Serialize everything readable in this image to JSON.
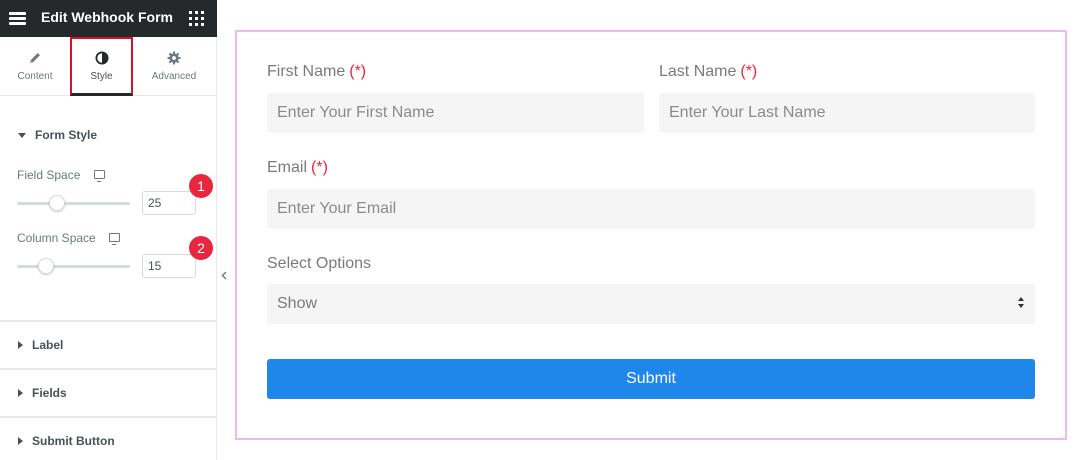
{
  "panel": {
    "title": "Edit Webhook Form",
    "tabs": [
      {
        "label": "Content",
        "icon": "pencil-icon"
      },
      {
        "label": "Style",
        "icon": "half-circle-icon",
        "active": true
      },
      {
        "label": "Advanced",
        "icon": "gear-icon"
      }
    ],
    "sections": {
      "form_style": {
        "title": "Form Style",
        "controls": [
          {
            "label": "Field Space",
            "value": "25",
            "badge": "1",
            "level_fraction": 0.25
          },
          {
            "label": "Column Space",
            "value": "15",
            "badge": "2",
            "level_fraction": 0.15
          }
        ]
      },
      "collapsed": [
        {
          "title": "Label"
        },
        {
          "title": "Fields"
        },
        {
          "title": "Submit Button"
        }
      ]
    }
  },
  "form": {
    "first_name": {
      "label": "First Name",
      "required": "(*)",
      "placeholder": "Enter Your First Name"
    },
    "last_name": {
      "label": "Last Name",
      "required": "(*)",
      "placeholder": "Enter Your Last Name"
    },
    "email": {
      "label": "Email",
      "required": "(*)",
      "placeholder": "Enter Your Email"
    },
    "select": {
      "label": "Select Options",
      "value": "Show"
    },
    "submit_label": "Submit"
  },
  "colors": {
    "topbar": "#26292c",
    "active_tab_outline": "#d6122b",
    "badge": "#e8263f",
    "required": "#e8263f",
    "submit": "#1f86ea",
    "frame_border": "#f0b8f0"
  }
}
